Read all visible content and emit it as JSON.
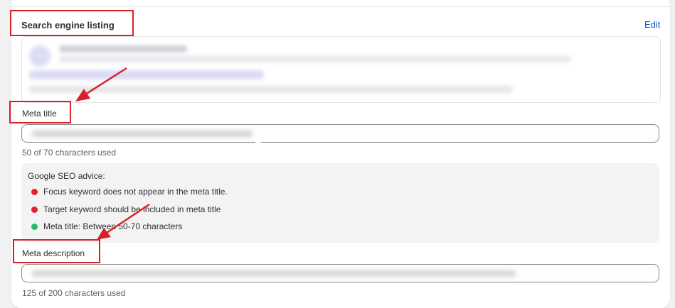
{
  "section": {
    "title": "Search engine listing",
    "edit_label": "Edit"
  },
  "meta_title": {
    "label": "Meta title",
    "char_count": "50 of 70 characters used"
  },
  "seo_advice": {
    "heading": "Google SEO advice:",
    "items": [
      {
        "text": "Focus keyword does not appear in the meta title.",
        "status_color": "#e5202e"
      },
      {
        "text": "Target keyword should be included in meta title",
        "status_color": "#e5202e"
      },
      {
        "text": "Meta title: Between 50-70 characters",
        "status_color": "#21c15e"
      }
    ]
  },
  "meta_description": {
    "label": "Meta description",
    "char_count": "125 of 200 characters used"
  },
  "colors": {
    "link": "#005bd3",
    "annotation": "#d9202a"
  }
}
